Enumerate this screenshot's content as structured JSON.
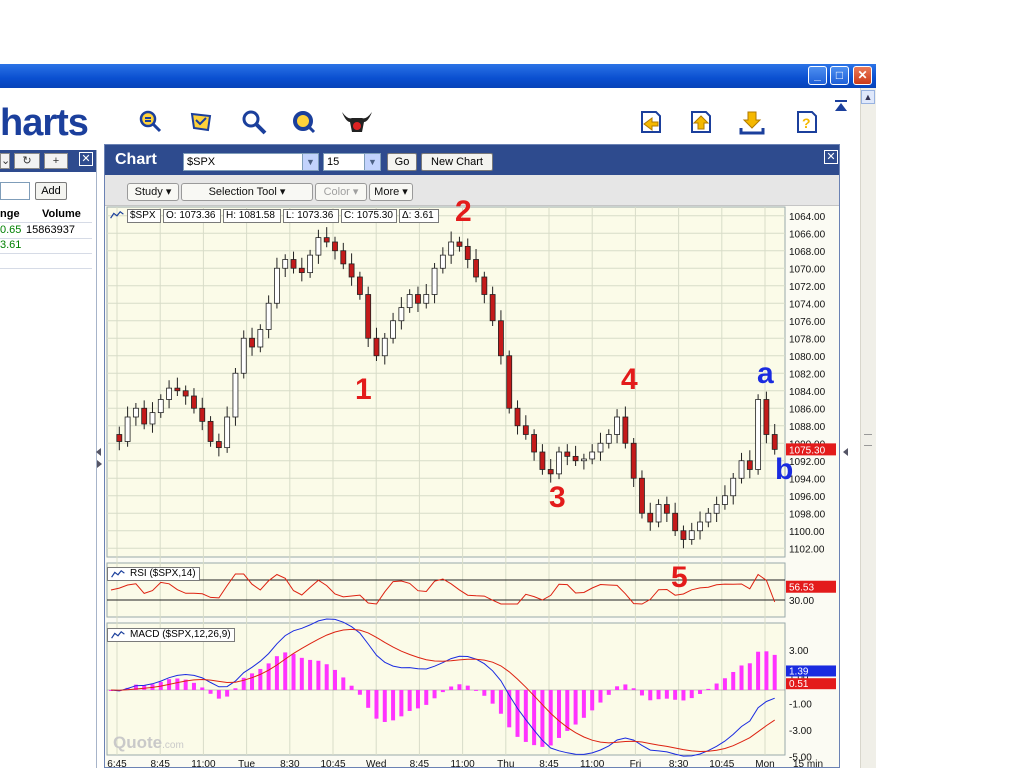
{
  "window": {
    "controls": {
      "minimize": "_",
      "maximize": "□",
      "close": "✕"
    }
  },
  "toolbar": {
    "logo": "harts",
    "icons": [
      "search-highlight-icon",
      "scroll-hand-icon",
      "zoom-icon",
      "refresh-q-icon",
      "bull-icon",
      "download-left-icon",
      "upload-icon",
      "download-tray-icon",
      "help-icon"
    ]
  },
  "left_panel": {
    "add_label": "Add",
    "headers": {
      "change": "nge",
      "volume": "Volume"
    },
    "rows": [
      {
        "change": "0.65",
        "volume": "15863937"
      },
      {
        "change": "3.61",
        "volume": ""
      }
    ],
    "colors": {
      "positive": "#008000"
    }
  },
  "chart_window": {
    "title": "Chart",
    "symbol": "$SPX",
    "period": "15",
    "go_label": "Go",
    "new_chart_label": "New Chart",
    "tools": {
      "study": "Study",
      "selection_tool": "Selection Tool",
      "color": "Color",
      "more": "More"
    },
    "watermark": {
      "brand": "Quote",
      "suffix": ".com"
    }
  },
  "price_panel": {
    "symbol": "$SPX",
    "open": "O: 1073.36",
    "high": "H: 1081.58",
    "low": "L: 1073.36",
    "close": "C: 1075.30",
    "delta": "Δ: 3.61",
    "last_price": "1075.30",
    "y_ticks": [
      "1102.00",
      "1100.00",
      "1098.00",
      "1096.00",
      "1094.00",
      "1092.00",
      "1090.00",
      "1088.00",
      "1086.00",
      "1084.00",
      "1082.00",
      "1080.00",
      "1078.00",
      "1076.00",
      "1074.00",
      "1072.00",
      "1070.00",
      "1068.00",
      "1066.00",
      "1064.00"
    ],
    "wave_labels": [
      {
        "text": "1",
        "color": "#e31b1b"
      },
      {
        "text": "2",
        "color": "#e31b1b"
      },
      {
        "text": "3",
        "color": "#e31b1b"
      },
      {
        "text": "4",
        "color": "#e31b1b"
      },
      {
        "text": "5",
        "color": "#e31b1b"
      },
      {
        "text": "a",
        "color": "#1a2be0"
      },
      {
        "text": "b",
        "color": "#1a2be0"
      }
    ]
  },
  "rsi_panel": {
    "label": "RSI ($SPX,14)",
    "value": "56.53",
    "level": "30.00"
  },
  "macd_panel": {
    "label": "MACD ($SPX,12,26,9)",
    "ticks": [
      "3.00",
      "1.00",
      "-1.00",
      "-3.00",
      "-5.00"
    ],
    "macd_value": "1.39",
    "signal_value": "0.51"
  },
  "time_axis": [
    "6:45",
    "8:45",
    "11:00",
    "Tue",
    "8:30",
    "10:45",
    "Wed",
    "8:45",
    "11:00",
    "Thu",
    "8:45",
    "11:00",
    "Fri",
    "8:30",
    "10:45",
    "Mon",
    "15 min"
  ],
  "chart_data": {
    "type": "candlestick",
    "interval": "15 min",
    "ylim": [
      1063,
      1103
    ],
    "y_ticks": [
      1064,
      1066,
      1068,
      1070,
      1072,
      1074,
      1076,
      1078,
      1080,
      1082,
      1084,
      1086,
      1088,
      1090,
      1092,
      1094,
      1096,
      1098,
      1100,
      1102
    ],
    "close_path": [
      1077,
      1076.2,
      1079,
      1080,
      1078.2,
      1079.5,
      1081,
      1082.3,
      1082,
      1081.4,
      1080,
      1078.5,
      1076.2,
      1075.5,
      1079,
      1084,
      1088,
      1087,
      1089,
      1092,
      1096,
      1097,
      1096,
      1095.5,
      1097.5,
      1099.5,
      1099,
      1098,
      1096.5,
      1095,
      1093,
      1088,
      1086,
      1088,
      1090,
      1091.5,
      1093,
      1092,
      1093,
      1096,
      1097.5,
      1099,
      1098.5,
      1097,
      1095,
      1093,
      1090,
      1086,
      1080,
      1078,
      1077,
      1075,
      1073,
      1072.5,
      1075,
      1074.5,
      1074,
      1074.2,
      1075,
      1076,
      1077,
      1079,
      1076,
      1072,
      1068,
      1067,
      1069,
      1068,
      1066,
      1065,
      1066,
      1067,
      1068,
      1069,
      1070,
      1072,
      1074,
      1073,
      1081,
      1077,
      1075.3
    ],
    "rsi_level": 30,
    "rsi_last": 56.53,
    "macd_ticks": [
      3,
      1,
      -1,
      -3,
      -5
    ],
    "macd_last": 1.39,
    "signal_last": 0.51
  }
}
